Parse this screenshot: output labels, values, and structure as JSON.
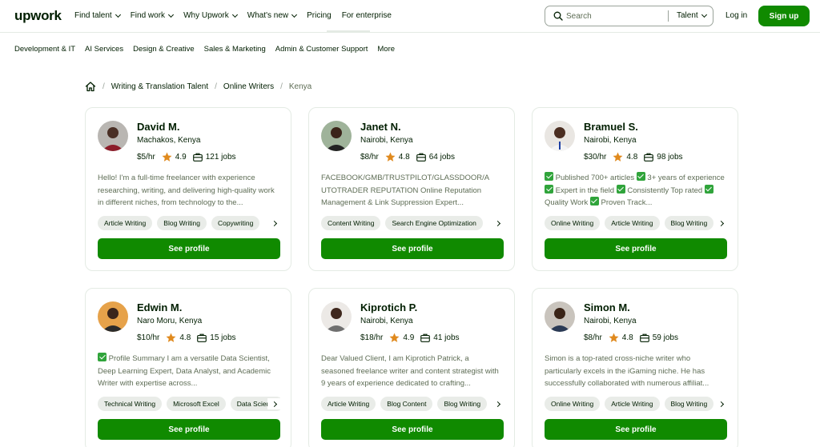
{
  "header": {
    "logo": "upwork",
    "nav": [
      {
        "label": "Find talent",
        "caret": true
      },
      {
        "label": "Find work",
        "caret": true
      },
      {
        "label": "Why Upwork",
        "caret": true
      },
      {
        "label": "What's new",
        "caret": true
      },
      {
        "label": "Pricing",
        "caret": false
      },
      {
        "label": "For enterprise",
        "caret": false
      }
    ],
    "search": {
      "placeholder": "Search",
      "scope": "Talent"
    },
    "login": "Log in",
    "signup": "Sign up"
  },
  "categories": [
    "Development & IT",
    "AI Services",
    "Design & Creative",
    "Sales & Marketing",
    "Admin & Customer Support",
    "More"
  ],
  "breadcrumb": {
    "items": [
      "Writing & Translation Talent",
      "Online Writers"
    ],
    "current": "Kenya",
    "separator": "/"
  },
  "colors": {
    "brand_green": "#108a00",
    "star": "#e08a1e",
    "text": "#001e00"
  },
  "see_profile_label": "See profile",
  "freelancers": [
    {
      "name": "David M.",
      "location": "Machakos, Kenya",
      "rate": "$5/hr",
      "rating": "4.9",
      "jobs": "121 jobs",
      "description": "Hello! I'm a full-time freelancer with experience researching, writing, and delivering high-quality work in different niches, from technology to the...",
      "skills": [
        "Article Writing",
        "Blog Writing",
        "Copywriting"
      ]
    },
    {
      "name": "Janet N.",
      "location": "Nairobi, Kenya",
      "rate": "$8/hr",
      "rating": "4.8",
      "jobs": "64 jobs",
      "description": "FACEBOOK/GMB/TRUSTPILOT/GLASSDOOR/A UTOTRADER REPUTATION Online Reputation Management & Link Suppression Expert...",
      "skills": [
        "Content Writing",
        "Search Engine Optimization"
      ]
    },
    {
      "name": "Bramuel S.",
      "location": "Nairobi, Kenya",
      "rate": "$30/hr",
      "rating": "4.8",
      "jobs": "98 jobs",
      "description_parts": [
        "Published 700+ articles",
        "3+ years of experience",
        "Expert in the field",
        "Consistently Top rated",
        "Quality Work",
        "Proven Track..."
      ],
      "skills": [
        "Online Writing",
        "Article Writing",
        "Blog Writing"
      ]
    },
    {
      "name": "Edwin M.",
      "location": "Naro Moru, Kenya",
      "rate": "$10/hr",
      "rating": "4.8",
      "jobs": "15 jobs",
      "description_parts": [
        "Profile Summary I am a versatile Data Scientist, Deep Learning Expert, Data Analyst, and Academic Writer with expertise across..."
      ],
      "skills": [
        "Technical Writing",
        "Microsoft Excel",
        "Data Science"
      ]
    },
    {
      "name": "Kiprotich P.",
      "location": "Nairobi, Kenya",
      "rate": "$18/hr",
      "rating": "4.9",
      "jobs": "41 jobs",
      "description": "Dear Valued Client, I am Kiprotich Patrick, a seasoned freelance writer and content strategist with 9 years of experience dedicated to crafting...",
      "skills": [
        "Article Writing",
        "Blog Content",
        "Blog Writing"
      ]
    },
    {
      "name": "Simon M.",
      "location": "Nairobi, Kenya",
      "rate": "$8/hr",
      "rating": "4.8",
      "jobs": "59 jobs",
      "description": "Simon is a top-rated cross-niche writer who particularly excels in the iGaming niche. He has successfully collaborated with numerous affiliat...",
      "skills": [
        "Online Writing",
        "Article Writing",
        "Blog Writing"
      ]
    }
  ]
}
